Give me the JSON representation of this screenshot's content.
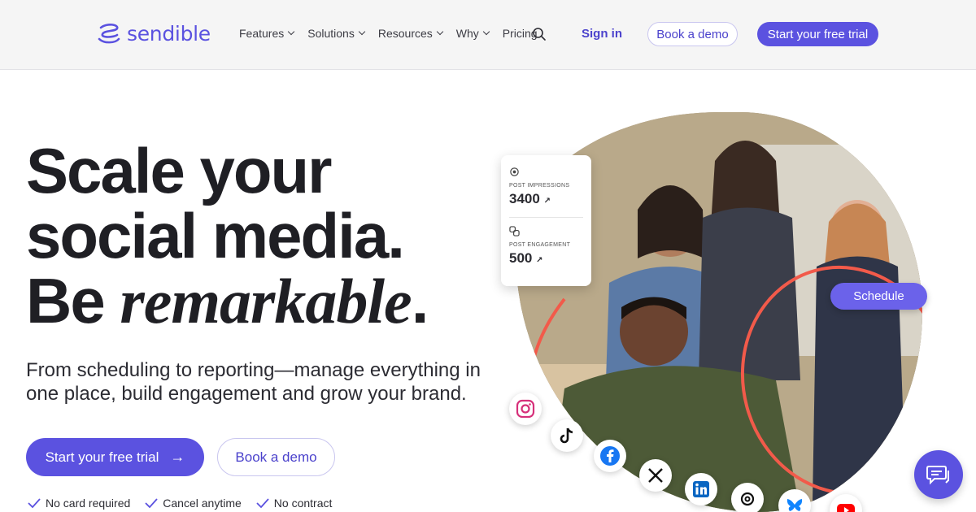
{
  "brand": {
    "name": "sendible",
    "accent": "#5b52e0"
  },
  "nav": {
    "items": [
      {
        "label": "Features"
      },
      {
        "label": "Solutions"
      },
      {
        "label": "Resources"
      },
      {
        "label": "Why"
      },
      {
        "label": "Pricing"
      }
    ],
    "sign_in": "Sign in",
    "book_demo": "Book a demo",
    "start_trial": "Start your free trial"
  },
  "hero": {
    "headline_line1": "Scale your",
    "headline_line2": "social media.",
    "headline_line3_plain": "Be ",
    "headline_line3_italic": "remarkable",
    "headline_line3_end": ".",
    "subtitle": "From scheduling to reporting—manage everything in one place, build engagement and grow your brand.",
    "cta_primary": "Start your free trial",
    "cta_primary_arrow": "→",
    "cta_secondary": "Book a demo",
    "perks": [
      "No card required",
      "Cancel anytime",
      "No contract"
    ]
  },
  "stats_card": {
    "impressions_label": "POST IMPRESSIONS",
    "impressions_value": "3400",
    "engagement_label": "POST ENGAGEMENT",
    "engagement_value": "500",
    "trend_glyph": "↗"
  },
  "schedule_label": "Schedule",
  "social_icons": [
    "instagram-icon",
    "tiktok-icon",
    "facebook-icon",
    "x-icon",
    "linkedin-icon",
    "threads-icon",
    "bluesky-icon",
    "youtube-icon"
  ]
}
